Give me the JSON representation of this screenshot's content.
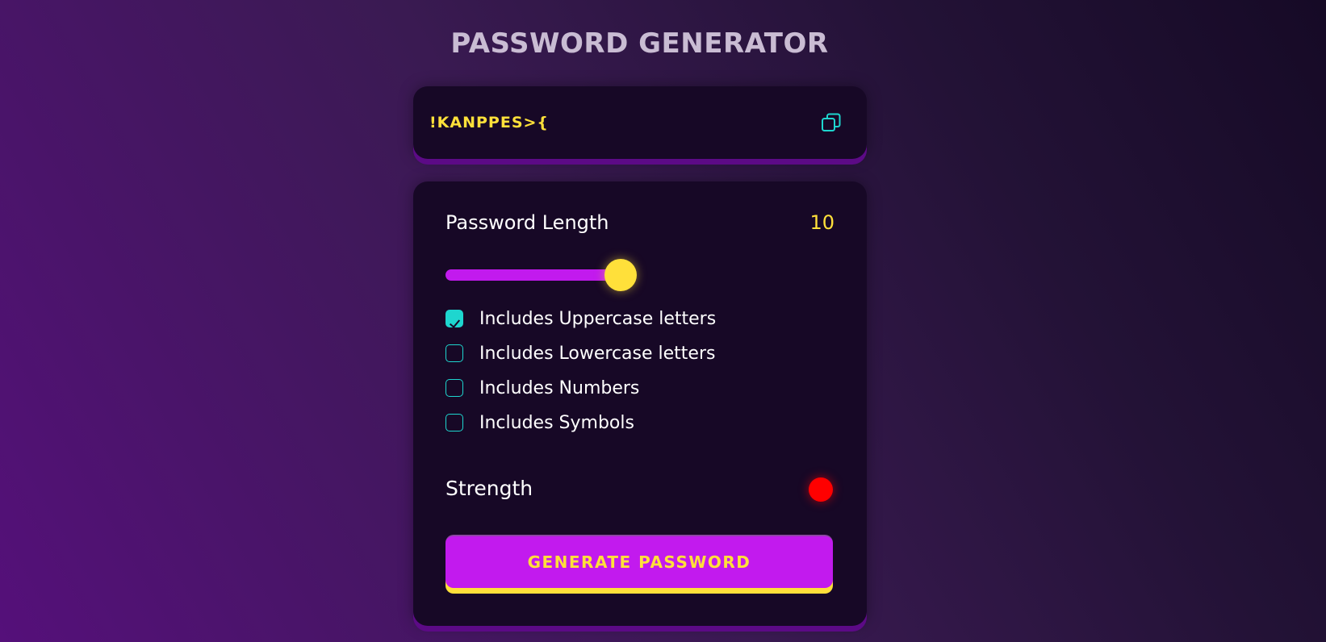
{
  "app": {
    "title": "PASSWORD GENERATOR"
  },
  "output": {
    "password": "!KANPPES>{",
    "copy_icon": "copy-icon"
  },
  "length": {
    "label": "Password Length",
    "value": "10",
    "slider_fraction": 0.45
  },
  "options": [
    {
      "label": "Includes Uppercase letters",
      "checked": true
    },
    {
      "label": "Includes Lowercase letters",
      "checked": false
    },
    {
      "label": "Includes Numbers",
      "checked": false
    },
    {
      "label": "Includes Symbols",
      "checked": false
    }
  ],
  "strength": {
    "label": "Strength",
    "indicator_color": "#ff0000"
  },
  "actions": {
    "generate_label": "GENERATE PASSWORD"
  },
  "colors": {
    "accent": "#c21aee",
    "highlight": "#ffe03a",
    "checkbox": "#1ed6cf",
    "card": "#170826"
  }
}
